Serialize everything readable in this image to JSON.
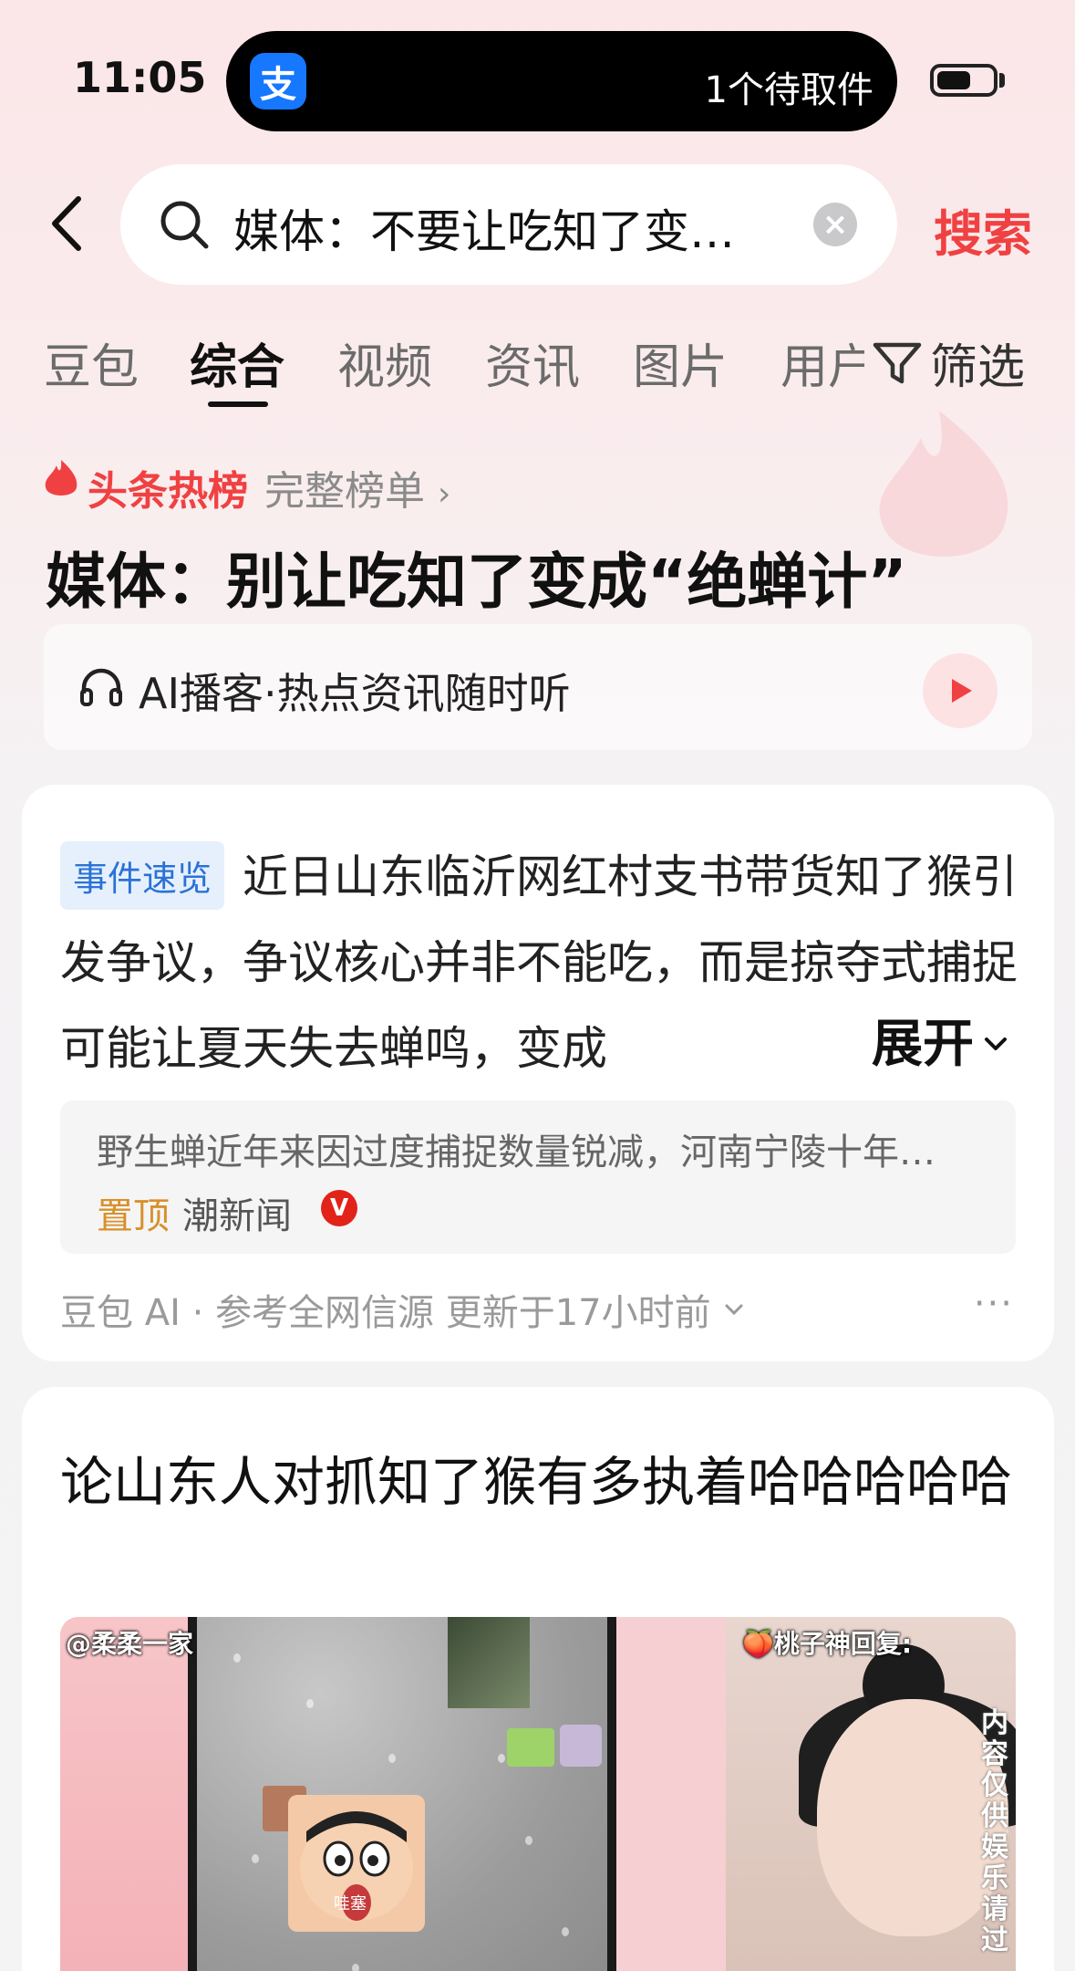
{
  "status_bar": {
    "time": "11:05",
    "island_app_glyph": "支",
    "island_text": "1个待取件"
  },
  "search": {
    "query": "媒体：不要让吃知了变…",
    "submit_label": "搜索"
  },
  "tabs": {
    "items": [
      "豆包",
      "综合",
      "视频",
      "资讯",
      "图片",
      "用户"
    ],
    "active": "综合",
    "filter_label": "筛选"
  },
  "hot_list": {
    "label": "头条热榜",
    "full_list_label": "完整榜单",
    "headline": "媒体：别让吃知了变成“绝蝉计”"
  },
  "podcast": {
    "label": "AI播客·热点资讯随时听"
  },
  "event_card": {
    "badge": "事件速览",
    "summary": "近日山东临沂网红村支书带货知了猴引发争议，争议核心并非不能吃，而是掠夺式捕捉可能让夏天失去蝉鸣，变成",
    "expand_label": "展开",
    "source_snippet": "野生蝉近年来因过度捕捉数量锐减，河南宁陵十年…",
    "pin_label": "置顶",
    "publisher": "潮新闻",
    "verified_mark": "V",
    "ai_meta": "豆包 AI · 参考全网信源 更新于17小时前",
    "more": "···"
  },
  "post_card": {
    "title": "论山东人对抓知了猴有多执着哈哈哈哈哈",
    "thumb_user": "@柔柔一家",
    "thumb_reply": "🍑桃子神回复:",
    "thumb_disclaimer": "内容仅供娱乐请过",
    "sticker_text": "哇塞"
  },
  "colors": {
    "accent_red": "#f04142",
    "active_tab": "#111111",
    "badge_blue": "#2a72d6",
    "pin_orange": "#d8902a"
  }
}
